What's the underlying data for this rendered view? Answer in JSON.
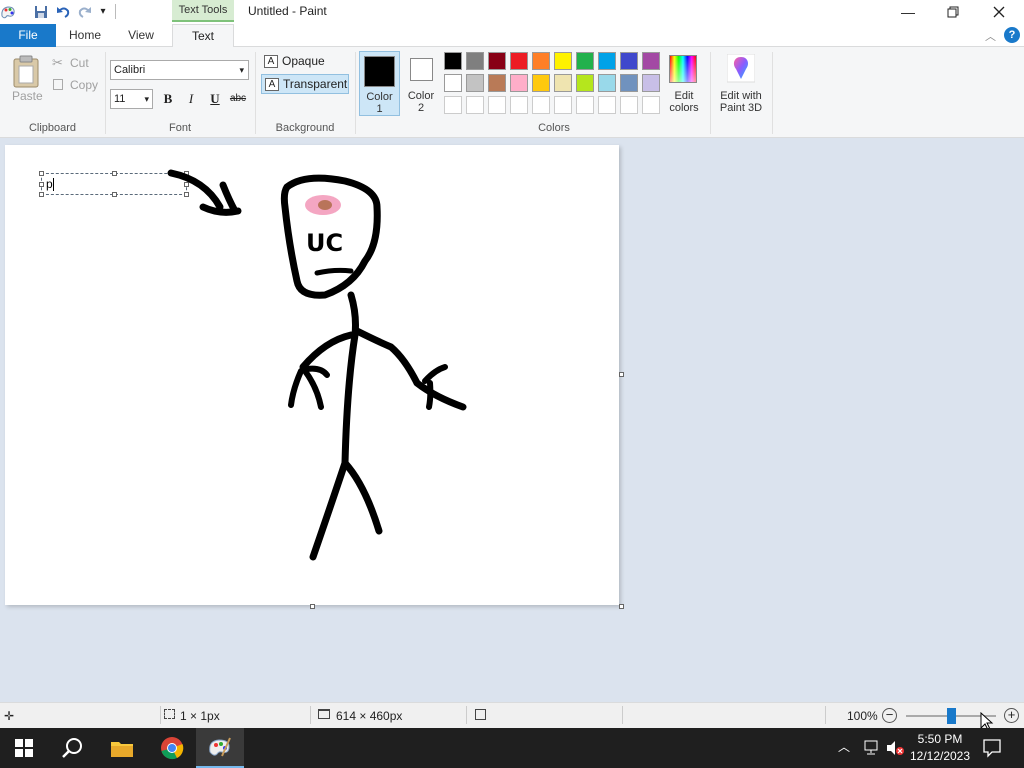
{
  "window": {
    "title": "Untitled - Paint",
    "context_tab": "Text Tools"
  },
  "tabs": {
    "file": "File",
    "home": "Home",
    "view": "View",
    "text": "Text"
  },
  "clipboard": {
    "paste": "Paste",
    "cut": "Cut",
    "copy": "Copy",
    "group": "Clipboard"
  },
  "font": {
    "family": "Calibri",
    "size": "11",
    "bold": "B",
    "italic": "I",
    "underline": "U",
    "strike": "abc",
    "group": "Font"
  },
  "background": {
    "opaque": "Opaque",
    "transparent": "Transparent",
    "group": "Background"
  },
  "colors": {
    "color1_label": "Color\n1",
    "color1": "#000000",
    "color2_label": "Color\n2",
    "color2": "#ffffff",
    "group": "Colors",
    "edit_colors": "Edit colors",
    "edit_paint3d": "Edit with Paint 3D",
    "palette_row1": [
      "#000000",
      "#7f7f7f",
      "#880015",
      "#ed1c24",
      "#ff7f27",
      "#fff200",
      "#22b14c",
      "#00a2e8",
      "#3f48cc",
      "#a349a4"
    ],
    "palette_row2": [
      "#ffffff",
      "#c3c3c3",
      "#b97a57",
      "#ffaec9",
      "#ffc90e",
      "#efe4b0",
      "#b5e61d",
      "#99d9ea",
      "#7092be",
      "#c8bfe7"
    ],
    "palette_row3": [
      "#ffffff",
      "#ffffff",
      "#ffffff",
      "#ffffff",
      "#ffffff",
      "#ffffff",
      "#ffffff",
      "#ffffff",
      "#ffffff",
      "#ffffff"
    ]
  },
  "canvas": {
    "text_box_content": "p",
    "drawing_text": "UC"
  },
  "status": {
    "selection": "1 × 1px",
    "canvas_size": "614 × 460px",
    "zoom": "100%",
    "zoom_level": 0.5
  },
  "taskbar": {
    "time": "5:50 PM",
    "date": "12/12/2023"
  }
}
